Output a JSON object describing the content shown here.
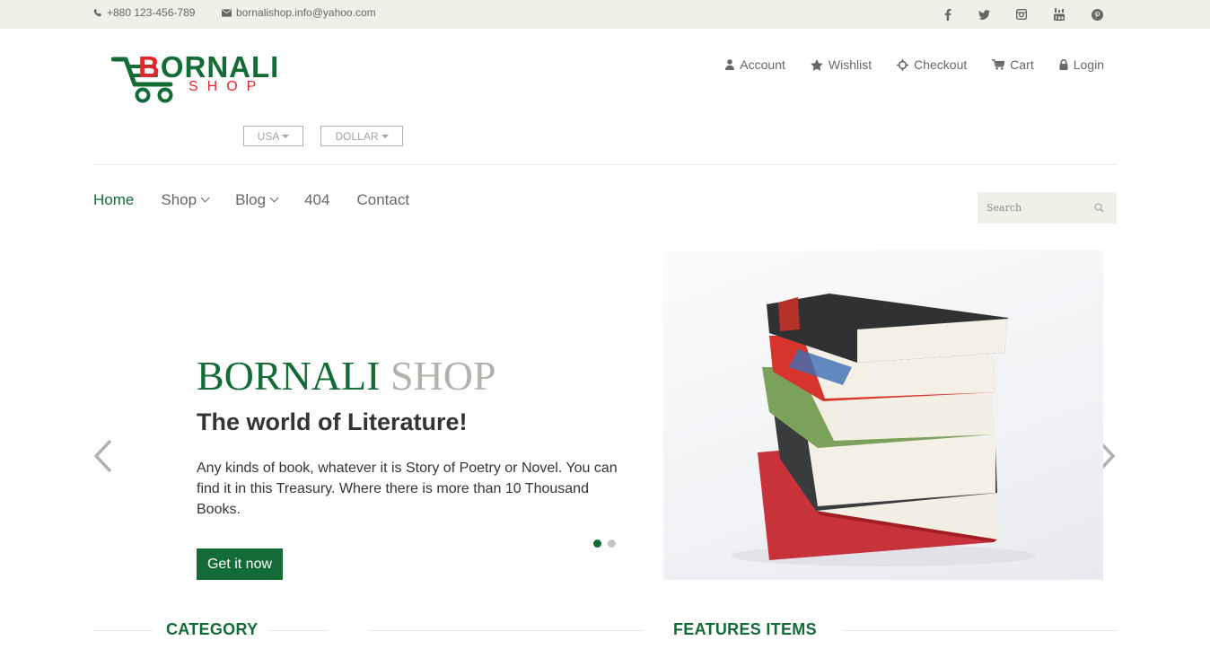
{
  "topbar": {
    "phone": "+880 123-456-789",
    "email": "bornalishop.info@yahoo.com",
    "social": [
      "facebook-icon",
      "twitter-icon",
      "instagram-icon",
      "youtube-icon",
      "pinterest-icon"
    ]
  },
  "logo": {
    "letter": "B",
    "word_rest": "ORNALI",
    "word2": "SHOP"
  },
  "account_menu": [
    {
      "icon": "user-icon",
      "label": "Account"
    },
    {
      "icon": "star-icon",
      "label": "Wishlist"
    },
    {
      "icon": "crosshair-icon",
      "label": "Checkout"
    },
    {
      "icon": "cart-icon",
      "label": "Cart"
    },
    {
      "icon": "lock-icon",
      "label": "Login"
    }
  ],
  "dropdowns": {
    "country": "USA",
    "currency": "DOLLAR"
  },
  "nav": [
    {
      "label": "Home",
      "active": true
    },
    {
      "label": "Shop",
      "has_dropdown": true
    },
    {
      "label": "Blog",
      "has_dropdown": true
    },
    {
      "label": "404"
    },
    {
      "label": "Contact"
    }
  ],
  "search": {
    "placeholder": "Search"
  },
  "slider": {
    "title_part1": "BORNALI",
    "title_part2": "SHOP",
    "subtitle": "The world of Literature!",
    "description": "Any kinds of book, whatever it is Story of Poetry or Novel. You can find it in this Treasury. Where there is more than 10 Thousand Books.",
    "cta_label": "Get it now",
    "slide_count": 2,
    "active_slide": 1
  },
  "sections": {
    "category": "CATEGORY",
    "features": "FEATURES ITEMS"
  },
  "colors": {
    "brand_green": "#136b36",
    "brand_red": "#e4262d",
    "topbar_bg": "#f0f0e9",
    "muted_text": "#696763"
  }
}
